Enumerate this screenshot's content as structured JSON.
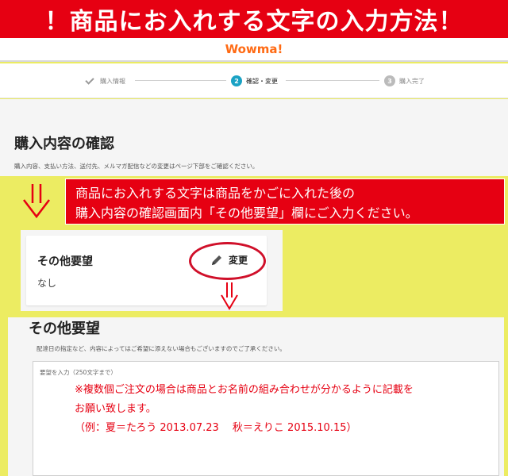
{
  "banner": {
    "title": "！商品にお入れする文字の入力方法！"
  },
  "header": {
    "logo": "Wowma!"
  },
  "steps": [
    {
      "num": "",
      "label": "購入情報",
      "state": "done"
    },
    {
      "num": "2",
      "label": "確認・変更",
      "state": "active"
    },
    {
      "num": "3",
      "label": "購入完了",
      "state": "pending"
    }
  ],
  "confirm": {
    "title": "購入内容の確認",
    "subtitle": "購入内容、支払い方法、送付先、メルマガ配信などの変更はページ下部をご確認ください。"
  },
  "instruction": {
    "line1": "商品にお入れする文字は商品をかごに入れた後の",
    "line2": "購入内容の確認画面内「その他要望」欄にご入力ください。"
  },
  "card": {
    "title": "その他要望",
    "value": "なし",
    "edit_label": "変更"
  },
  "form": {
    "title": "その他要望",
    "note": "配達日の指定など、内容によってはご希望に添えない場合もございますのでご了承ください。",
    "field_label": "要望を入力（250文字まで）",
    "example_line1": "※複数個ご注文の場合は商品とお名前の組み合わせが分かるように記載を",
    "example_line2": "お願い致します。",
    "example_line3": "（例：夏＝たろう 2013.07.23　 秋＝えりこ 2015.10.15）"
  },
  "colors": {
    "brand_red": "#e60012",
    "logo_orange": "#ff6a13",
    "step_active": "#1aa2c4",
    "highlight_yellow": "#ecec62"
  }
}
